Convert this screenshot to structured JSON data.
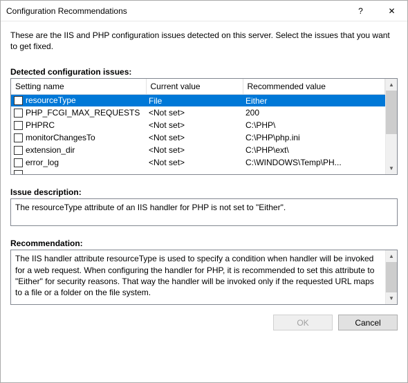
{
  "window": {
    "title": "Configuration Recommendations",
    "help_glyph": "?",
    "close_glyph": "✕"
  },
  "intro": "These are the IIS and PHP configuration issues detected on this server. Select the issues that you want to get fixed.",
  "issues": {
    "label": "Detected configuration issues:",
    "columns": {
      "setting": "Setting name",
      "current": "Current value",
      "recommended": "Recommended value"
    },
    "rows": [
      {
        "setting": "resourceType",
        "current": "File",
        "recommended": "Either",
        "selected": true
      },
      {
        "setting": "PHP_FCGI_MAX_REQUESTS",
        "current": "<Not set>",
        "recommended": "200",
        "selected": false
      },
      {
        "setting": "PHPRC",
        "current": "<Not set>",
        "recommended": "C:\\PHP\\",
        "selected": false
      },
      {
        "setting": "monitorChangesTo",
        "current": "<Not set>",
        "recommended": "C:\\PHP\\php.ini",
        "selected": false
      },
      {
        "setting": "extension_dir",
        "current": "<Not set>",
        "recommended": "C:\\PHP\\ext\\",
        "selected": false
      },
      {
        "setting": "error_log",
        "current": "<Not set>",
        "recommended": "C:\\WINDOWS\\Temp\\PH...",
        "selected": false
      }
    ]
  },
  "description": {
    "label": "Issue description:",
    "text": "The resourceType attribute of an IIS handler for PHP is not set to \"Either\"."
  },
  "recommendation": {
    "label": "Recommendation:",
    "text": "The IIS handler attribute resourceType is used to specify a condition when handler will be invoked for a web request. When configuring the handler for PHP, it is recommended to set this attribute to \"Either\" for security reasons. That way the handler will be invoked only if the requested URL maps to a file or a folder on the file system."
  },
  "buttons": {
    "ok": "OK",
    "cancel": "Cancel"
  },
  "scroll": {
    "up": "▲",
    "down": "▼"
  }
}
